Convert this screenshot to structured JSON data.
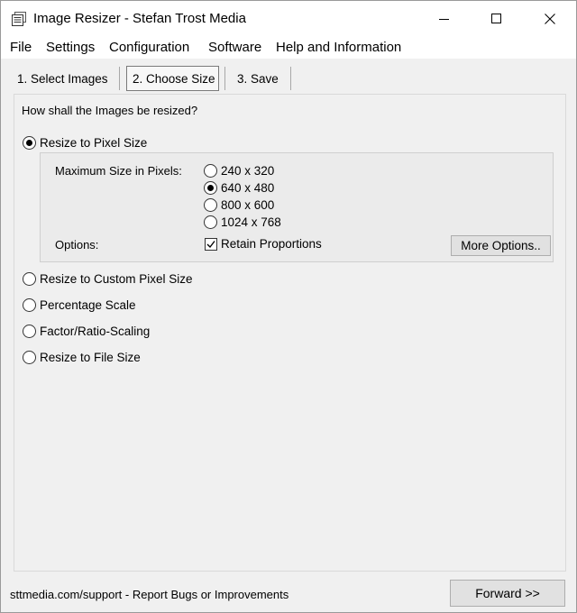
{
  "window": {
    "title": "Image Resizer - Stefan Trost Media"
  },
  "menu": [
    "File",
    "Settings",
    "Configuration",
    "Software",
    "Help and Information"
  ],
  "tabs": [
    {
      "label": "1. Select Images",
      "active": false
    },
    {
      "label": "2. Choose Size",
      "active": true
    },
    {
      "label": "3. Save",
      "active": false
    }
  ],
  "main": {
    "question": "How shall the Images be resized?",
    "modes": [
      {
        "label": "Resize to Pixel Size",
        "checked": true
      },
      {
        "label": "Resize to Custom Pixel Size",
        "checked": false
      },
      {
        "label": "Percentage Scale",
        "checked": false
      },
      {
        "label": "Factor/Ratio-Scaling",
        "checked": false
      },
      {
        "label": "Resize to File Size",
        "checked": false
      }
    ],
    "pixel_size": {
      "max_label": "Maximum Size in Pixels:",
      "sizes": [
        {
          "label": "240 x 320",
          "checked": false
        },
        {
          "label": "640 x 480",
          "checked": true
        },
        {
          "label": "800 x 600",
          "checked": false
        },
        {
          "label": "1024 x 768",
          "checked": false
        }
      ],
      "options_label": "Options:",
      "retain_label": "Retain Proportions",
      "retain_checked": true,
      "more_options_label": "More Options.."
    }
  },
  "footer": {
    "link_text": "sttmedia.com/support - Report Bugs or Improvements",
    "forward_label": "Forward >>"
  }
}
